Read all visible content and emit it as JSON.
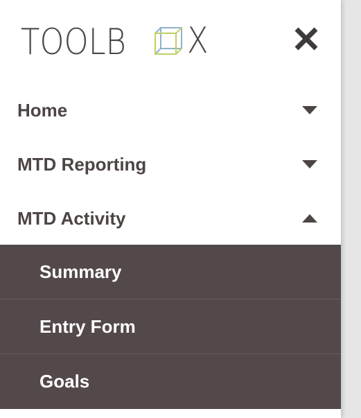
{
  "brand": {
    "logo_left": "TOOLB",
    "logo_right": "X"
  },
  "header": {
    "close_icon": "close-icon"
  },
  "menu": {
    "items": [
      {
        "label": "Home",
        "icon": "chevron-down-icon",
        "expanded": false
      },
      {
        "label": "MTD Reporting",
        "icon": "chevron-down-icon",
        "expanded": false
      },
      {
        "label": "MTD Activity",
        "icon": "chevron-up-icon",
        "expanded": true
      }
    ],
    "submenu": [
      {
        "label": "Summary"
      },
      {
        "label": "Entry Form"
      },
      {
        "label": "Goals"
      }
    ]
  },
  "colors": {
    "text": "#4d4444",
    "submenu_bg": "#53484a",
    "submenu_text": "#ffffff",
    "divider": "#e3e3e3",
    "logo_cube_blue": "#8fb1c8",
    "logo_cube_green": "#c2d26a"
  }
}
